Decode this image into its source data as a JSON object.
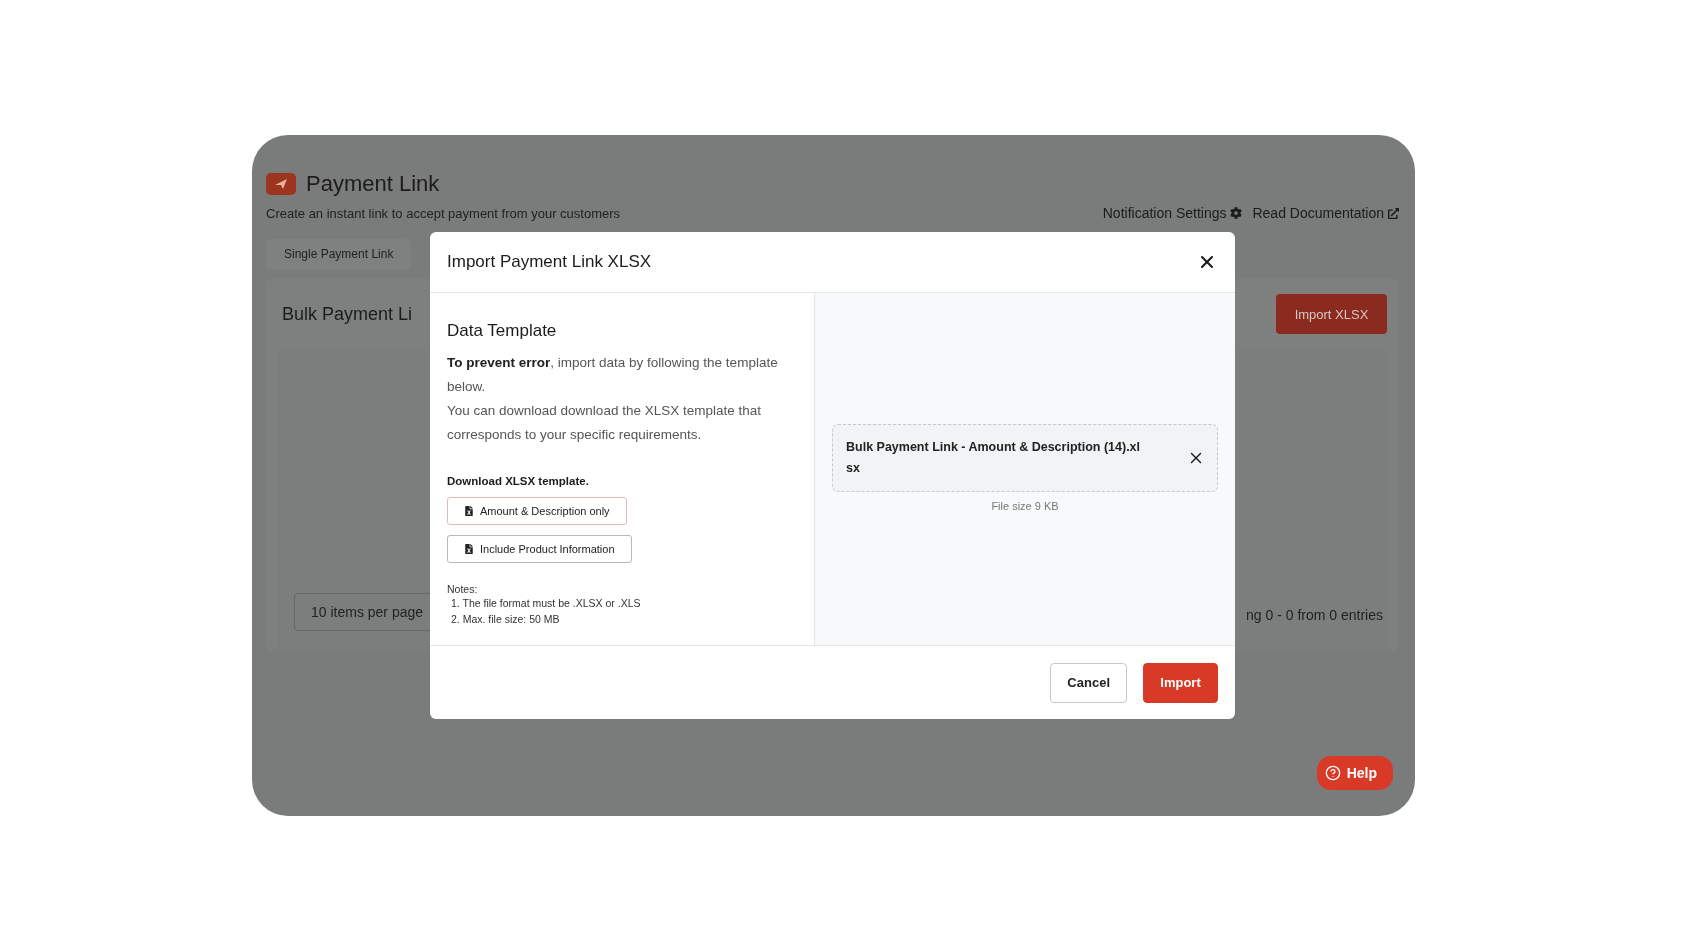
{
  "page": {
    "title": "Payment Link",
    "subtitle": "Create an instant link to accept payment from your customers",
    "links": [
      {
        "label": "Notification Settings",
        "kind": "settings"
      },
      {
        "label": "Read Documentation",
        "kind": "external"
      }
    ]
  },
  "tabs": [
    "Single Payment Link"
  ],
  "bulk_card": {
    "title": "Bulk Payment Li",
    "import_button": "Import XLSX",
    "per_page": "10 items per page",
    "entries": "ng 0 - 0 from 0 entries"
  },
  "help_button": "Help",
  "modal": {
    "title": "Import Payment Link XLSX",
    "section_title": "Data Template",
    "intro": "**To prevent error**, import data by following the template below.",
    "intro_2": "You can download download the XLSX template that corresponds to your specific requirements.",
    "download_label": "Download XLSX template.",
    "template_buttons": [
      {
        "label": "Amount & Description only",
        "focused": true
      },
      {
        "label": "Include Product Information",
        "focused": false
      }
    ],
    "notes_label": "Notes:",
    "notes": [
      "1. The file format must be .XLSX or .XLS",
      "2. Max. file size: 50 MB"
    ],
    "file": {
      "name": "Bulk Payment Link - Amount & Description (14).xlsx",
      "size": "File size 9 KB"
    },
    "buttons": [
      {
        "label": "Cancel",
        "kind": "secondary"
      },
      {
        "label": "Import",
        "kind": "primary"
      }
    ]
  }
}
